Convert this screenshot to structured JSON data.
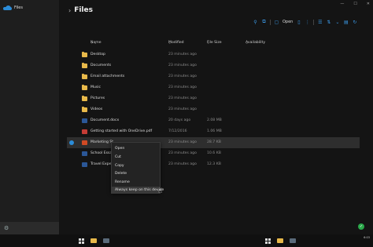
{
  "app": {
    "title": "Files"
  },
  "main": {
    "title": "Files"
  },
  "window": {
    "minimize": "—",
    "maximize": "☐",
    "close": "✕"
  },
  "toolbar": {
    "open_label": "Open"
  },
  "columns": {
    "name": "Name",
    "modified": "Modified",
    "size": "File Size",
    "availability": "Availability"
  },
  "files": [
    {
      "name": "Desktop",
      "modified": "23 minutes ago",
      "size": "",
      "type": "folder"
    },
    {
      "name": "Documents",
      "modified": "23 minutes ago",
      "size": "",
      "type": "folder"
    },
    {
      "name": "Email attachments",
      "modified": "23 minutes ago",
      "size": "",
      "type": "folder"
    },
    {
      "name": "Music",
      "modified": "23 minutes ago",
      "size": "",
      "type": "folder"
    },
    {
      "name": "Pictures",
      "modified": "23 minutes ago",
      "size": "",
      "type": "folder"
    },
    {
      "name": "Videos",
      "modified": "23 minutes ago",
      "size": "",
      "type": "folder"
    },
    {
      "name": "Document.docx",
      "modified": "20 days ago",
      "size": "2.08 MB",
      "type": "word"
    },
    {
      "name": "Getting started with OneDrive.pdf",
      "modified": "7/12/2016",
      "size": "1.06 MB",
      "type": "pdf"
    },
    {
      "name": "Marketing St...",
      "modified": "23 minutes ago",
      "size": "28.7 KB",
      "type": "ppt"
    },
    {
      "name": "School Essay",
      "modified": "23 minutes ago",
      "size": "10.6 KB",
      "type": "word"
    },
    {
      "name": "Travel Expen...",
      "modified": "23 minutes ago",
      "size": "12.3 KB",
      "type": "word"
    }
  ],
  "context_menu": [
    "Open",
    "Cut",
    "Copy",
    "Delete",
    "Rename",
    "Always keep on this device"
  ],
  "taskbar": {
    "time": "6:03",
    "date": ""
  },
  "colors": {
    "accent": "#2b8cd8",
    "folder": "#e8b94a",
    "selected_row": "#2e2e2e"
  }
}
